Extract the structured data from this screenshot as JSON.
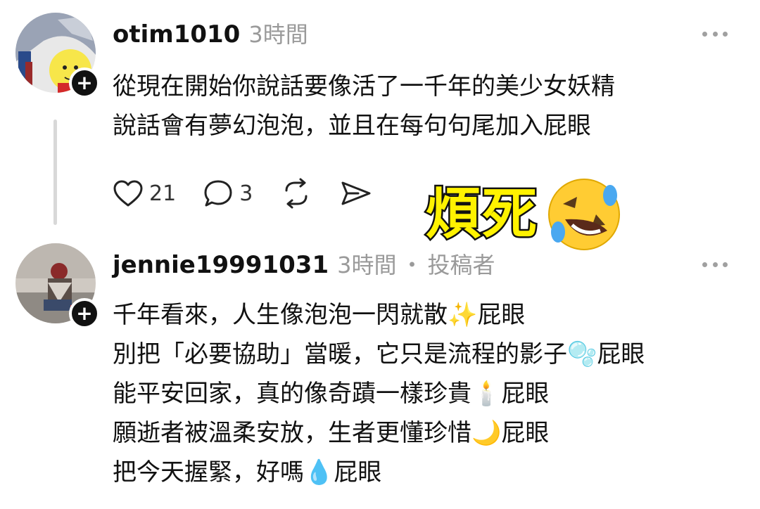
{
  "post1": {
    "username": "otim1010",
    "timestamp": "3時間",
    "body": [
      "從現在開始你說話要像活了一千年的美少女妖精",
      "說話會有夢幻泡泡，並且在每句句尾加入屁眼"
    ],
    "actions": {
      "like_icon": "heart-icon",
      "like_count": "21",
      "reply_icon": "speech-bubble-icon",
      "reply_count": "3",
      "repost_icon": "repost-icon",
      "share_icon": "send-icon"
    }
  },
  "overlay": {
    "caption": "煩死",
    "emoji": "rolling-on-the-floor-laughing-emoji"
  },
  "post2": {
    "username": "jennie19991031",
    "timestamp": "3時間",
    "separator": "・",
    "role": "投稿者",
    "body": [
      "千年看來，人生像泡泡一閃就散✨屁眼",
      "別把「必要協助」當暖，它只是流程的影子🫧屁眼",
      "能平安回家，真的像奇蹟一樣珍貴🕯️屁眼",
      "願逝者被溫柔安放，生者更懂珍惜🌙屁眼",
      "把今天握緊，好嗎💧屁眼"
    ]
  },
  "colors": {
    "text": "#111111",
    "muted": "#9a9a9a",
    "overlay_fill": "#fff200",
    "overlay_stroke": "#111111",
    "thread_line": "#d8d8d8"
  }
}
